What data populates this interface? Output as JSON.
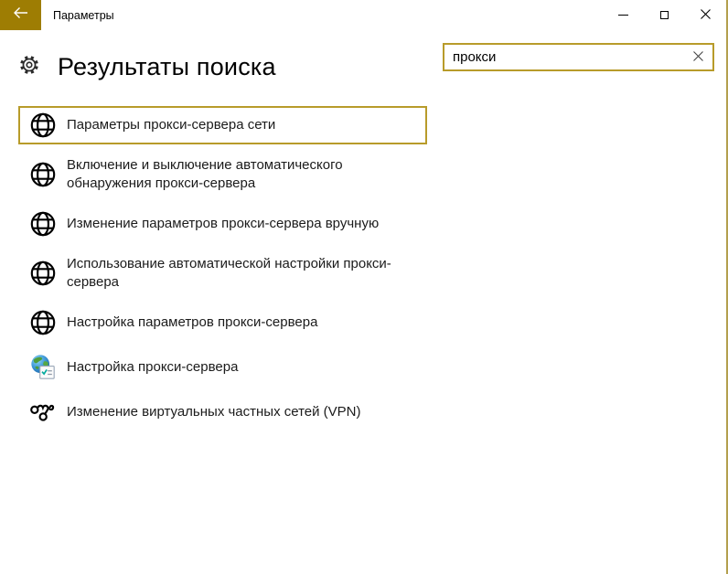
{
  "window": {
    "title": "Параметры"
  },
  "header": {
    "title": "Результаты поиска"
  },
  "search": {
    "value": "прокси"
  },
  "results": {
    "items": [
      {
        "label": "Параметры прокси-сервера сети",
        "icon": "globe-icon",
        "selected": true
      },
      {
        "label": "Включение и выключение автоматического\nобнаружения прокси-сервера",
        "icon": "globe-icon",
        "selected": false
      },
      {
        "label": "Изменение параметров прокси-сервера вручную",
        "icon": "globe-icon",
        "selected": false
      },
      {
        "label": "Использование автоматической настройки прокси-\nсервера",
        "icon": "globe-icon",
        "selected": false
      },
      {
        "label": "Настройка параметров прокси-сервера",
        "icon": "globe-icon",
        "selected": false
      },
      {
        "label": "Настройка прокси-сервера",
        "icon": "internet-options-icon",
        "selected": false
      },
      {
        "label": "Изменение виртуальных частных сетей (VPN)",
        "icon": "vpn-icon",
        "selected": false
      }
    ]
  },
  "colors": {
    "accent_titlebar_back": "#9e7d03",
    "accent_border": "#b89b2a",
    "window_edge": "#b3a04e",
    "text": "#1b1b1b"
  }
}
